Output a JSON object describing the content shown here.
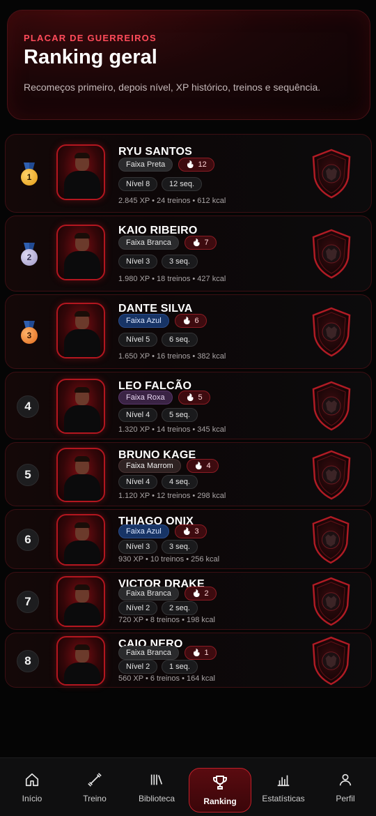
{
  "header": {
    "eyebrow": "PLACAR DE GUERREIROS",
    "title": "Ranking geral",
    "subtitle": "Recomeços primeiro, depois nível, XP histórico, treinos e sequência."
  },
  "colors": {
    "accent": "#ff4b5a",
    "card_border": "#3c0f13",
    "active_nav": "#c0202a"
  },
  "ranking": [
    {
      "position": "1",
      "medal": "gold",
      "name": "RYU SANTOS",
      "belt": "Faixa Preta",
      "belt_style": "preta",
      "restarts": "12",
      "level": "Nível 8",
      "streak": "12 seq.",
      "stats": "2.845 XP  •  24 treinos  •  612 kcal",
      "emblem": "samurai-helmet-icon"
    },
    {
      "position": "2",
      "medal": "silver",
      "name": "KAIO RIBEIRO",
      "belt": "Faixa Branca",
      "belt_style": "branca",
      "restarts": "7",
      "level": "Nível 3",
      "streak": "3 seq.",
      "stats": "1.980 XP  •  18 treinos  •  427 kcal",
      "emblem": "lion-icon"
    },
    {
      "position": "3",
      "medal": "bronze",
      "name": "DANTE SILVA",
      "belt": "Faixa Azul",
      "belt_style": "azul",
      "restarts": "6",
      "level": "Nível 5",
      "streak": "6 seq.",
      "stats": "1.650 XP  •  16 treinos  •  382 kcal",
      "emblem": "wolf-icon"
    },
    {
      "position": "4",
      "medal": "",
      "name": "LEO FALCÃO",
      "belt": "Faixa Roxa",
      "belt_style": "roxa",
      "restarts": "5",
      "level": "Nível 4",
      "streak": "5 seq.",
      "stats": "1.320 XP  •  14 treinos  •  345 kcal",
      "emblem": "panther-icon"
    },
    {
      "position": "5",
      "medal": "",
      "name": "BRUNO KAGE",
      "belt": "Faixa Marrom",
      "belt_style": "marrom",
      "restarts": "4",
      "level": "Nível 4",
      "streak": "4 seq.",
      "stats": "1.120 XP  •  12 treinos  •  298 kcal",
      "emblem": "shuriken-icon"
    },
    {
      "position": "6",
      "medal": "",
      "name": "THIAGO ONIX",
      "belt": "Faixa Azul",
      "belt_style": "azul",
      "restarts": "3",
      "level": "Nível 3",
      "streak": "3 seq.",
      "stats": "930 XP  •  10 treinos  •  256 kcal",
      "emblem": "snake-icon"
    },
    {
      "position": "7",
      "medal": "",
      "name": "VICTOR DRAKE",
      "belt": "Faixa Branca",
      "belt_style": "branca",
      "restarts": "2",
      "level": "Nível 2",
      "streak": "2 seq.",
      "stats": "720 XP  •  8 treinos  •  198 kcal",
      "emblem": "dragon-icon"
    },
    {
      "position": "8",
      "medal": "",
      "name": "CAIO NERO",
      "belt": "Faixa Branca",
      "belt_style": "branca",
      "restarts": "1",
      "level": "Nível 2",
      "streak": "1 seq.",
      "stats": "560 XP  •  6 treinos  •  164 kcal",
      "emblem": "wolf-icon"
    }
  ],
  "nav": [
    {
      "label": "Início",
      "icon": "home-icon",
      "active": false
    },
    {
      "label": "Treino",
      "icon": "dumbbell-icon",
      "active": false
    },
    {
      "label": "Biblioteca",
      "icon": "library-icon",
      "active": false
    },
    {
      "label": "Ranking",
      "icon": "trophy-icon",
      "active": true
    },
    {
      "label": "Estatísticas",
      "icon": "bar-chart-icon",
      "active": false
    },
    {
      "label": "Perfil",
      "icon": "user-icon",
      "active": false
    }
  ]
}
